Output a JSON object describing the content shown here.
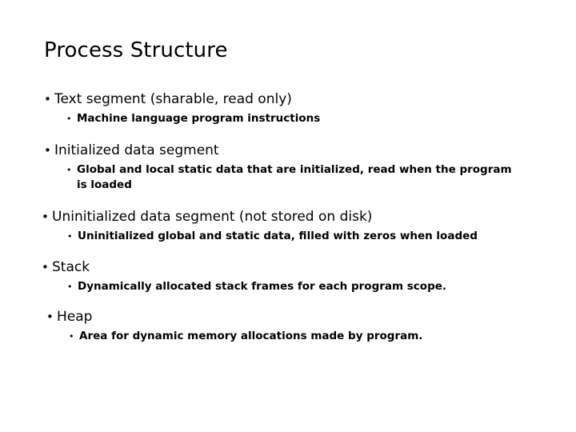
{
  "slide": {
    "title": "Process Structure",
    "bullet_glyph_level1": "•",
    "bullet_glyph_level2": "•",
    "text_color": "#000000",
    "background_color": "#ffffff",
    "groups": [
      {
        "heading": "Text segment (sharable, read only)",
        "sub": "Machine language program instructions"
      },
      {
        "heading": "Initialized data segment",
        "sub": "Global and local static data that are initialized, read when the program is loaded"
      },
      {
        "heading": "Uninitialized data segment (not stored on disk)",
        "sub": "Uninitialized global and static data, filled with zeros when loaded"
      },
      {
        "heading": "Stack",
        "sub": "Dynamically allocated stack frames for each program scope."
      },
      {
        "heading": "Heap",
        "sub": "Area for dynamic memory allocations made by program."
      }
    ]
  }
}
